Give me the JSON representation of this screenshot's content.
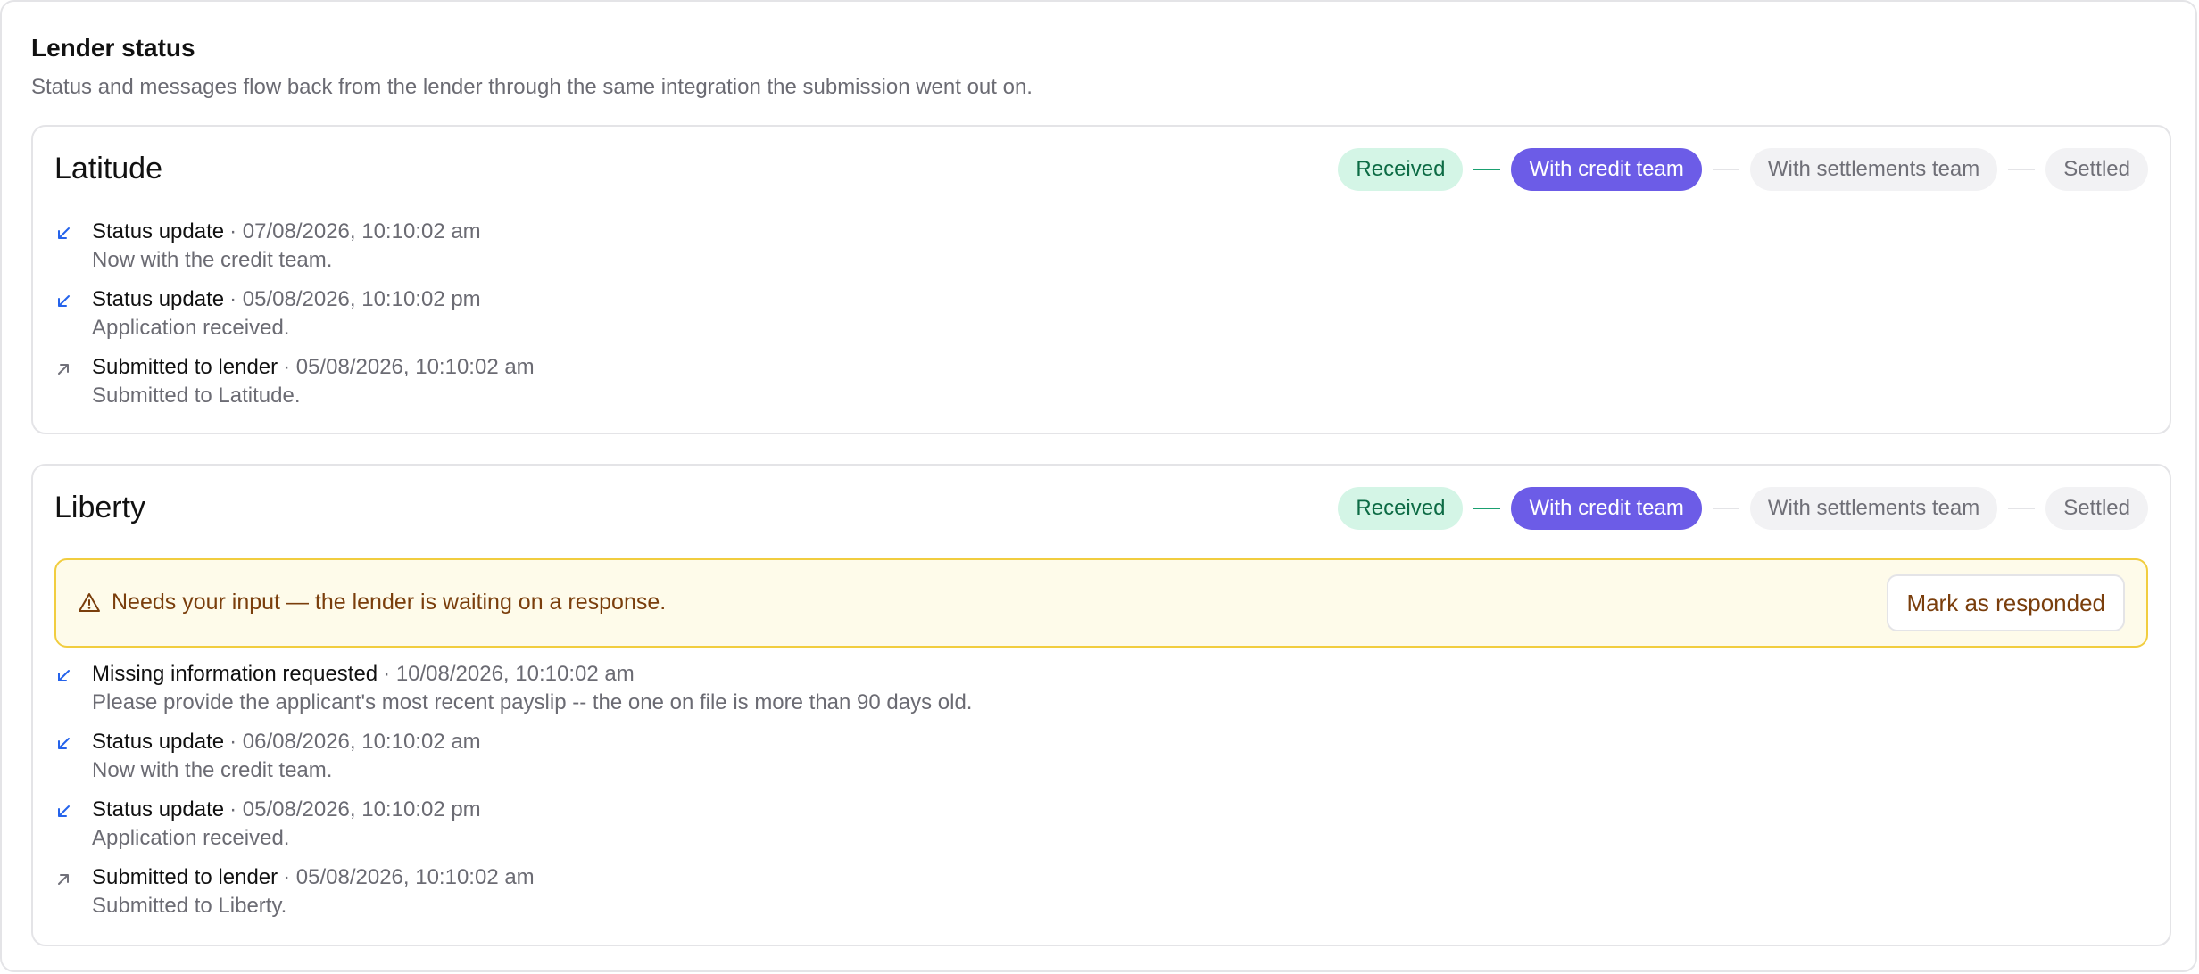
{
  "section": {
    "title": "Lender status",
    "subtitle": "Status and messages flow back from the lender through the same integration the submission went out on."
  },
  "colors": {
    "received_bg": "#d4f5e6",
    "received_text": "#0d6b45",
    "current_bg": "#6c5ce7",
    "pending_bg": "#f2f2f4",
    "alert_bg": "#fefbea",
    "alert_border": "#f1cd3f",
    "alert_text": "#7a3e0c"
  },
  "lenders": [
    {
      "name": "Latitude",
      "steps": [
        "Received",
        "With credit team",
        "With settlements team",
        "Settled"
      ],
      "current_step": 1,
      "events": [
        {
          "direction": "incoming",
          "icon": "arrow-down-left-icon",
          "title": "Status update",
          "time": "· 07/08/2026, 10:10:02 am",
          "description": "Now with the credit team."
        },
        {
          "direction": "incoming",
          "icon": "arrow-down-left-icon",
          "title": "Status update",
          "time": "· 05/08/2026, 10:10:02 pm",
          "description": "Application received."
        },
        {
          "direction": "outgoing",
          "icon": "arrow-up-right-icon",
          "title": "Submitted to lender",
          "time": "· 05/08/2026, 10:10:02 am",
          "description": "Submitted to Latitude."
        }
      ]
    },
    {
      "name": "Liberty",
      "steps": [
        "Received",
        "With credit team",
        "With settlements team",
        "Settled"
      ],
      "current_step": 1,
      "alert": {
        "icon": "warning-icon",
        "text": "Needs your input — the lender is waiting on a response.",
        "button": "Mark as responded"
      },
      "events": [
        {
          "direction": "incoming",
          "icon": "arrow-down-left-icon",
          "title": "Missing information requested",
          "time": "· 10/08/2026, 10:10:02 am",
          "description": "Please provide the applicant's most recent payslip -- the one on file is more than 90 days old."
        },
        {
          "direction": "incoming",
          "icon": "arrow-down-left-icon",
          "title": "Status update",
          "time": "· 06/08/2026, 10:10:02 am",
          "description": "Now with the credit team."
        },
        {
          "direction": "incoming",
          "icon": "arrow-down-left-icon",
          "title": "Status update",
          "time": "· 05/08/2026, 10:10:02 pm",
          "description": "Application received."
        },
        {
          "direction": "outgoing",
          "icon": "arrow-up-right-icon",
          "title": "Submitted to lender",
          "time": "· 05/08/2026, 10:10:02 am",
          "description": "Submitted to Liberty."
        }
      ]
    }
  ]
}
